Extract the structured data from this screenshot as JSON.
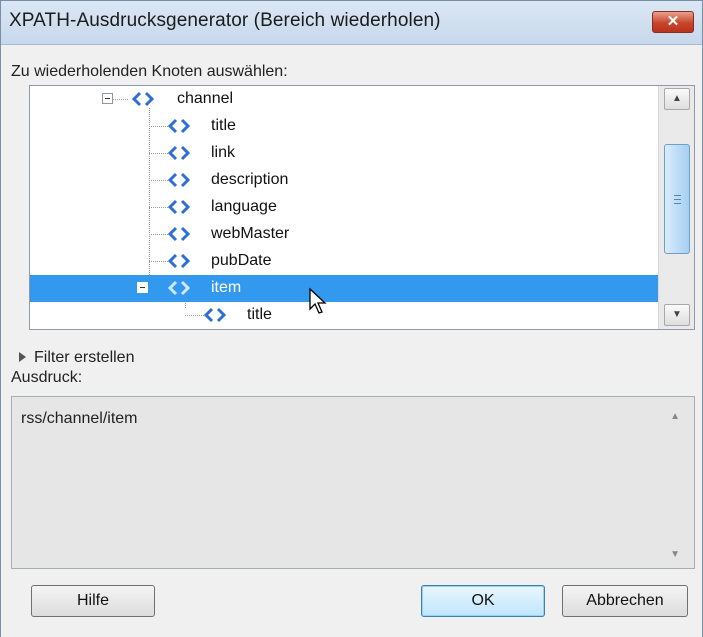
{
  "window": {
    "title": "XPATH-Ausdrucksgenerator (Bereich wiederholen)",
    "close_glyph": "✕"
  },
  "select_label": "Zu wiederholenden Knoten auswählen:",
  "tree": {
    "items": [
      {
        "label": "channel",
        "level": 0,
        "expander": "minus",
        "selected": false
      },
      {
        "label": "title",
        "level": 1,
        "selected": false
      },
      {
        "label": "link",
        "level": 1,
        "selected": false
      },
      {
        "label": "description",
        "level": 1,
        "selected": false
      },
      {
        "label": "language",
        "level": 1,
        "selected": false
      },
      {
        "label": "webMaster",
        "level": 1,
        "selected": false
      },
      {
        "label": "pubDate",
        "level": 1,
        "selected": false
      },
      {
        "label": "item",
        "level": 1,
        "expander": "minus",
        "selected": true
      },
      {
        "label": "title",
        "level": 2,
        "selected": false
      }
    ],
    "node_icon": "element-node-icon",
    "node_color": "#2e6fd6"
  },
  "filter": {
    "label": "Filter erstellen",
    "icon": "expand-triangle-icon"
  },
  "expression": {
    "label": "Ausdruck:",
    "value": "rss/channel/item"
  },
  "buttons": {
    "help": "Hilfe",
    "ok": "OK",
    "cancel": "Abbrechen"
  },
  "colors": {
    "selection": "#3399ee",
    "close_button": "#c8452c"
  }
}
